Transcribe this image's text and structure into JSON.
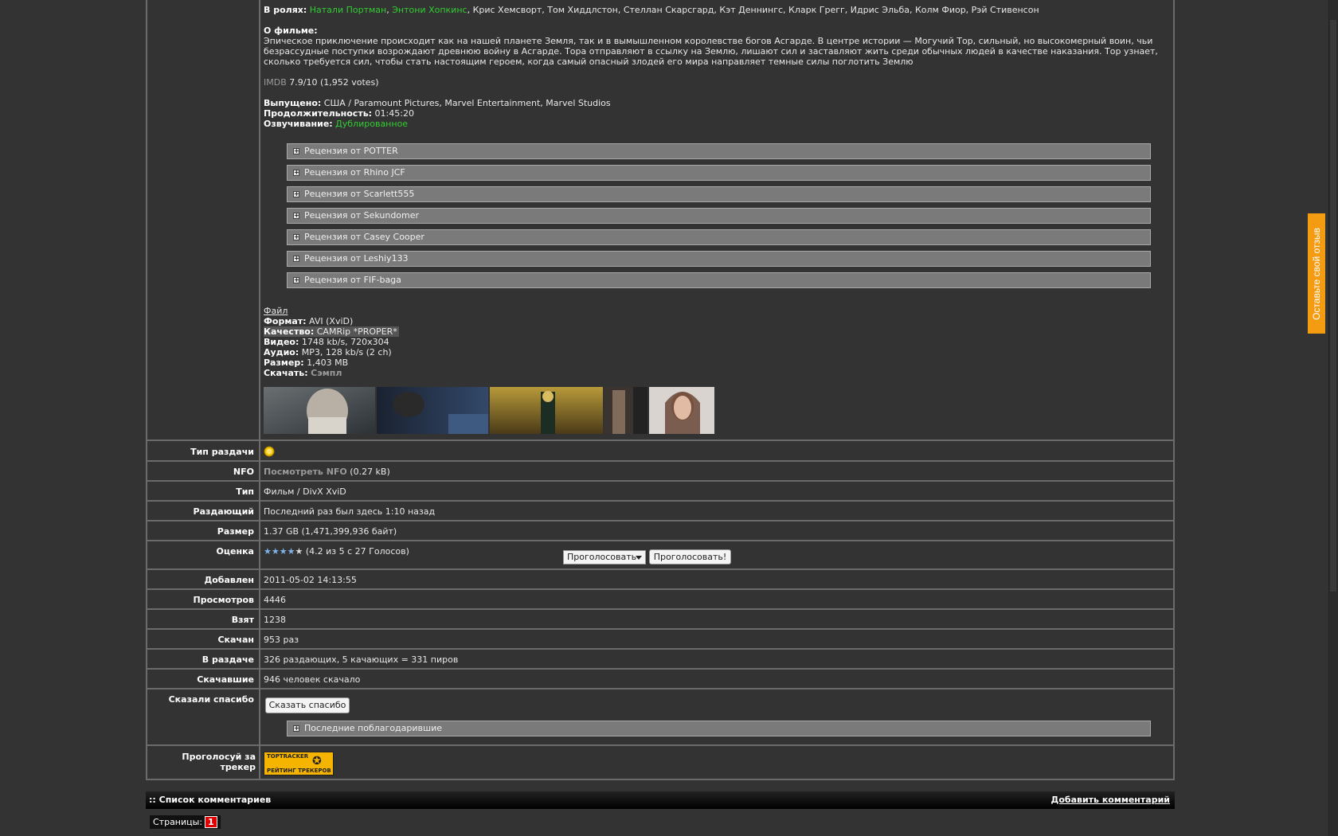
{
  "desc": {
    "cast_label": "В ролях:",
    "cast_green1": "Натали Портман",
    "sep": ", ",
    "cast_green2": "Энтони Хопкинс",
    "cast_rest": ", Крис Хемсворт, Том Хиддлстон, Стеллан Скарсгард, Кэт Деннингс, Кларк Грегг, Идрис Эльба, Колм Фиор, Рэй Стивенсон",
    "about_label": "О фильме:",
    "about_text": "Эпическое приключение происходит как на нашей планете Земля, так и в вымышленном королевстве богов Асгарде. В центре истории — Могучий Тор, сильный, но высокомерный воин, чьи безрассудные поступки возрождают древнюю войну в Асгарде. Тора отправляют в ссылку на Землю, лишают сил и заставляют жить среди обычных людей в качестве наказания. Тор узнает, сколько требуется сил, чтобы стать настоящим героем, когда самый опасный злодей его мира направляет темные силы поглотить Землю",
    "imdb_label": "IMDB",
    "imdb_value": " 7.9/10 (1,952 votes)",
    "released_label": "Выпущено:",
    "released_value": " США / Paramount Pictures, Marvel Entertainment, Marvel Studios",
    "duration_label": "Продолжительность:",
    "duration_value": " 01:45:20",
    "dub_label": "Озвучивание:",
    "dub_value": " Дублированное",
    "reviews": [
      "Рецензия от POTTER",
      "Рецензия от Rhino JCF",
      "Рецензия от Scarlett555",
      "Рецензия от Sekundomer",
      "Рецензия от Casey Cooper",
      "Рецензия от Leshiy133",
      "Рецензия от FIF-baga"
    ],
    "file_label": "Файл",
    "format_label": "Формат:",
    "format_value": " AVI (XviD)",
    "quality_label": "Качество:",
    "quality_value": " CAMRip *PROPER*",
    "video_label": "Видео:",
    "video_value": " 1748 kb/s, 720x304",
    "audio_label": "Аудио:",
    "audio_value": " MP3, 128 kb/s (2 ch)",
    "size_label": "Размер:",
    "size_value": " 1,403 MB",
    "download_label": "Скачать:",
    "download_value": "Сэмпл"
  },
  "details": {
    "type_label": "Тип раздачи",
    "nfo_label": "NFO",
    "nfo_link": "Посмотреть NFO",
    "nfo_size": " (0.27 kB)",
    "kind_label": "Тип",
    "kind_value": "Фильм / DivX XviD",
    "seeder_label": "Раздающий",
    "seeder_value": "Последний раз был здесь 1:10 назад",
    "size_label": "Размер",
    "size_value": "1.37 GB (1,471,399,936 байт)",
    "rating_label": "Оценка",
    "rating_stars_filled": "★★★★",
    "rating_stars_empty": "★",
    "rating_text": "(4.2 из 5 с 27 Голосов)",
    "vote_select": "Проголосовать",
    "vote_button": "Проголосовать!",
    "added_label": "Добавлен",
    "added_value": "2011-05-02 14:13:55",
    "views_label": "Просмотров",
    "views_value": "4446",
    "taken_label": "Взят",
    "taken_value": "1238",
    "downloaded_label": "Скачан",
    "downloaded_value": "953 раз",
    "seeding_label": "В раздаче",
    "seeding_value": "326 раздающих, 5 качающих = 331 пиров",
    "completed_label": "Скачавшие",
    "completed_value": "946 человек скачало",
    "thanks_label": "Сказали спасибо",
    "thanks_button": "Сказать спасибо",
    "thanks_spoiler": "Последние поблагодарившие",
    "vote_tracker_label": "Проголосуй за трекер",
    "toptracker_line1": "TOPTRACKER",
    "toptracker_line2": "РЕЙТИНГ ТРЕКЕРОВ"
  },
  "comments": {
    "title": ":: Список комментариев",
    "add": "Добавить комментарий",
    "pages_label": "Страницы:",
    "page1": "1"
  },
  "feedback_tab": "Оставьте свой отзыв",
  "colors": {
    "background": "#333333",
    "link_green": "#33cc33",
    "spoiler_bg": "#7a7a7a",
    "feedback_orange": "#f39c12",
    "page_red": "#e00000"
  }
}
